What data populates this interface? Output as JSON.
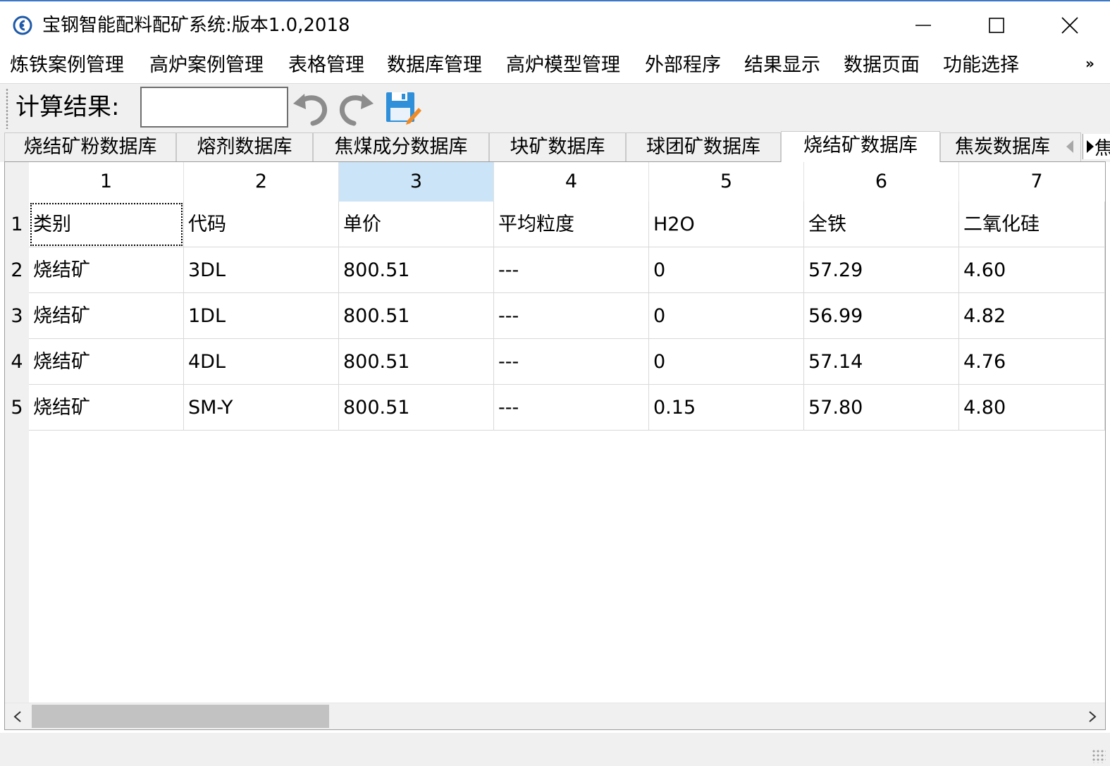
{
  "window": {
    "title": "宝钢智能配料配矿系统:版本1.0,2018"
  },
  "menu": {
    "items": [
      "炼铁案例管理",
      "高炉案例管理",
      "表格管理",
      "数据库管理",
      "高炉模型管理",
      "外部程序",
      "结果显示",
      "数据页面",
      "功能选择"
    ],
    "more": "»"
  },
  "toolbar": {
    "calc_label": "计算结果:",
    "calc_value": ""
  },
  "tabs": {
    "items": [
      "烧结矿粉数据库",
      "熔剂数据库",
      "焦煤成分数据库",
      "块矿数据库",
      "球团矿数据库",
      "烧结矿数据库",
      "焦炭数据库"
    ],
    "active": "烧结矿数据库",
    "overflow_text": "焦"
  },
  "grid": {
    "col_headers": [
      "1",
      "2",
      "3",
      "4",
      "5",
      "6",
      "7"
    ],
    "selected_col": "3",
    "row_headers": [
      "1",
      "2",
      "3",
      "4",
      "5"
    ],
    "rows": [
      [
        "类别",
        "代码",
        "单价",
        "平均粒度",
        "H2O",
        "全铁",
        "二氧化硅"
      ],
      [
        "烧结矿",
        "3DL",
        "800.51",
        "---",
        "0",
        "57.29",
        "4.60"
      ],
      [
        "烧结矿",
        "1DL",
        "800.51",
        "---",
        "0",
        "56.99",
        "4.82"
      ],
      [
        "烧结矿",
        "4DL",
        "800.51",
        "---",
        "0",
        "57.14",
        "4.76"
      ],
      [
        "烧结矿",
        "SM-Y",
        "800.51",
        "---",
        "0.15",
        "57.80",
        "4.80"
      ]
    ]
  },
  "colors": {
    "selected_header": "#cce4f7",
    "chrome": "#f0f0f0",
    "save_icon_blue": "#2f8fd8"
  }
}
